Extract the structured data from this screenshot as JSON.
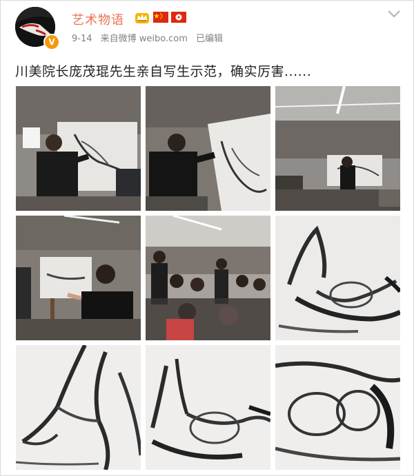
{
  "post": {
    "username": "艺术物语",
    "date": "9-14",
    "source": "来自微博 weibo.com",
    "edited": "已编辑",
    "text": "川美院长庞茂琨先生亲自写生示范，确实厉害......",
    "avatar_badge": "V",
    "colors": {
      "username": "#eb7350",
      "meta": "#808080",
      "badge": "#f29a0e"
    },
    "icons": [
      "avatar",
      "vip-crown-icon",
      "china-flag-icon",
      "hong-kong-flag-icon",
      "chevron-down-icon"
    ]
  },
  "photos": [
    {
      "subject": "artist drawing at easel"
    },
    {
      "subject": "artist drawing at easel close"
    },
    {
      "subject": "studio wide view"
    },
    {
      "subject": "artist speaking beside drawing"
    },
    {
      "subject": "audience watching"
    },
    {
      "subject": "figure drawing full"
    },
    {
      "subject": "figure drawing legs detail"
    },
    {
      "subject": "figure drawing lower detail"
    },
    {
      "subject": "figure drawing torso detail"
    }
  ]
}
